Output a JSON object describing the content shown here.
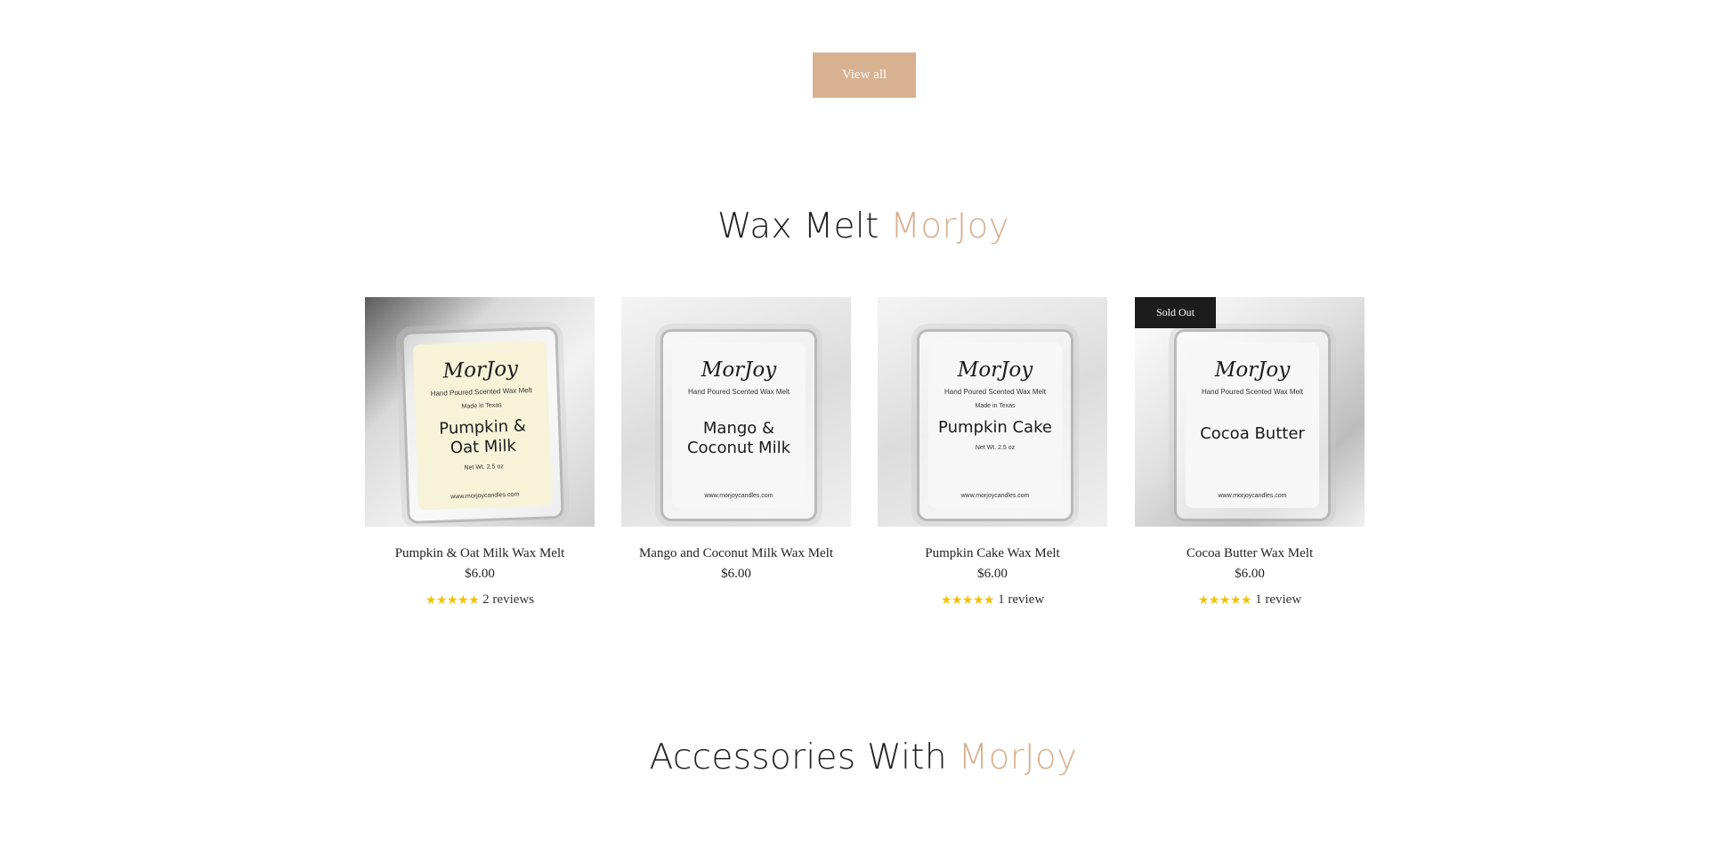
{
  "view_all": {
    "label": "View all"
  },
  "wax_section": {
    "title_main": "Wax Melt ",
    "title_accent": "MorJoy"
  },
  "accessories_section": {
    "title_main": "Accessories With ",
    "title_accent": "MorJoy"
  },
  "colors": {
    "accent": "#d8b190",
    "badge_bg": "#1c1c1c",
    "stars": "#f2c200"
  },
  "products": [
    {
      "title": "Pumpkin & Oat Milk Wax Melt",
      "price": "$6.00",
      "stars": "★★★★★",
      "rating": 5,
      "reviews": "2 reviews",
      "image": {
        "brand": "MorJoy",
        "tagline": "Hand Poured Scented Wax Melt",
        "origin": "Made in Texas",
        "scent": "Pumpkin &\nOat Milk",
        "weight": "Net Wt. 2.5 oz",
        "site": "www.morjoycandles.com"
      }
    },
    {
      "title": "Mango and Coconut Milk Wax Melt",
      "price": "$6.00",
      "image": {
        "brand": "MorJoy",
        "tagline": "Hand Poured Scented Wax Melt",
        "scent": "Mango &\nCoconut Milk",
        "site": "www.morjoycandles.com"
      }
    },
    {
      "title": "Pumpkin Cake Wax Melt",
      "price": "$6.00",
      "stars": "★★★★★",
      "rating": 5,
      "reviews": "1 review",
      "image": {
        "brand": "MorJoy",
        "tagline": "Hand Poured Scented Wax Melt",
        "origin": "Made in Texas",
        "scent": "Pumpkin Cake",
        "weight": "Net Wt. 2.5 oz",
        "site": "www.morjoycandles.com"
      }
    },
    {
      "title": "Cocoa Butter Wax Melt",
      "price": "$6.00",
      "badge": "Sold Out",
      "stars": "★★★★★",
      "rating": 5,
      "reviews": "1 review",
      "image": {
        "brand": "MorJoy",
        "tagline": "Hand Poured Scented Wax Melt",
        "scent": "Cocoa Butter",
        "site": "www.morjoycandles.com"
      }
    }
  ]
}
